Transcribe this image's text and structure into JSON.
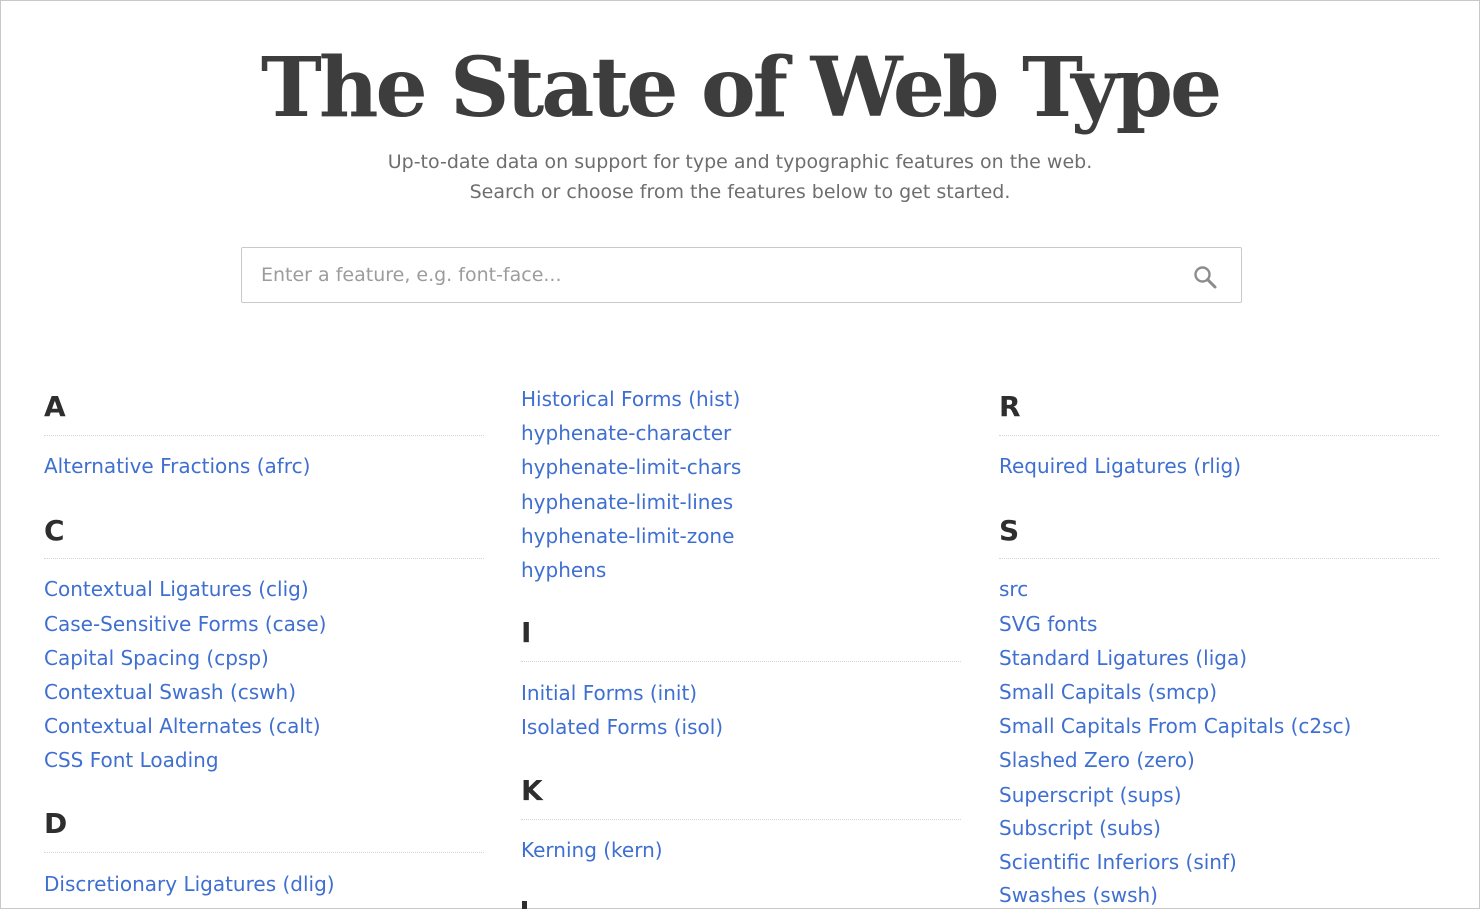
{
  "header": {
    "title": "The State of Web Type",
    "subtitle_line1": "Up-to-date data on support for type and typographic features on the web.",
    "subtitle_line2": "Search or choose from the features below to get started."
  },
  "search": {
    "placeholder": "Enter a feature, e.g. font-face...",
    "value": "",
    "icon": "search-icon"
  },
  "colors": {
    "link": "#3f6fd0",
    "heading": "#2e2e2e",
    "subtitle": "#6e6e6e"
  },
  "column1": {
    "A": {
      "letter": "A",
      "items": [
        "Alternative Fractions (afrc)"
      ]
    },
    "C": {
      "letter": "C",
      "items": [
        "Contextual Ligatures (clig)",
        "Case-Sensitive Forms (case)",
        "Capital Spacing (cpsp)",
        "Contextual Swash (cswh)",
        "Contextual Alternates (calt)",
        "CSS Font Loading"
      ]
    },
    "D": {
      "letter": "D",
      "items": [
        "Discretionary Ligatures (dlig)"
      ]
    }
  },
  "column2": {
    "H_cont": {
      "items": [
        "Historical Forms (hist)",
        "hyphenate-character",
        "hyphenate-limit-chars",
        "hyphenate-limit-lines",
        "hyphenate-limit-zone",
        "hyphens"
      ]
    },
    "I": {
      "letter": "I",
      "items": [
        "Initial Forms (init)",
        "Isolated Forms (isol)"
      ]
    },
    "K": {
      "letter": "K",
      "items": [
        "Kerning (kern)"
      ]
    }
  },
  "column3": {
    "R": {
      "letter": "R",
      "items": [
        "Required Ligatures (rlig)"
      ]
    },
    "S": {
      "letter": "S",
      "items": [
        "src",
        "SVG fonts",
        "Standard Ligatures (liga)",
        "Small Capitals (smcp)",
        "Small Capitals From Capitals (c2sc)",
        "Slashed Zero (zero)",
        "Superscript (sups)",
        "Subscript (subs)",
        "Scientific Inferiors (sinf)",
        "Swashes (swsh)"
      ]
    }
  }
}
